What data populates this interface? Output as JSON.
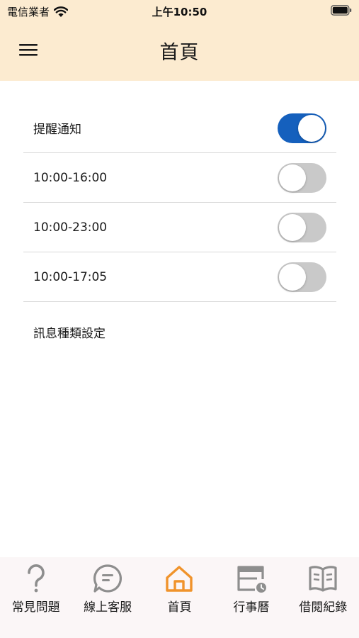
{
  "status_bar": {
    "carrier": "電信業者",
    "time": "上午10:50"
  },
  "nav": {
    "title": "首頁",
    "menu_icon": "hamburger-menu-icon"
  },
  "settings": {
    "reminder_label": "提醒通知",
    "reminder_on": true,
    "time_slots": [
      {
        "label": "10:00-16:00",
        "on": false
      },
      {
        "label": "10:00-23:00",
        "on": false
      },
      {
        "label": "10:00-17:05",
        "on": false
      }
    ],
    "message_type_label": "訊息種類設定"
  },
  "tabs": [
    {
      "label": "常見問題",
      "icon": "question-icon",
      "active": false
    },
    {
      "label": "線上客服",
      "icon": "chat-bubble-icon",
      "active": false
    },
    {
      "label": "首頁",
      "icon": "home-icon",
      "active": true
    },
    {
      "label": "行事曆",
      "icon": "calendar-icon",
      "active": false
    },
    {
      "label": "借閱紀錄",
      "icon": "book-icon",
      "active": false
    }
  ],
  "colors": {
    "header_bg": "#fcebd0",
    "toggle_on": "#1560bd",
    "toggle_off": "#c9c9c9",
    "tab_active": "#f0932b",
    "tab_inactive": "#8e8e8e"
  }
}
